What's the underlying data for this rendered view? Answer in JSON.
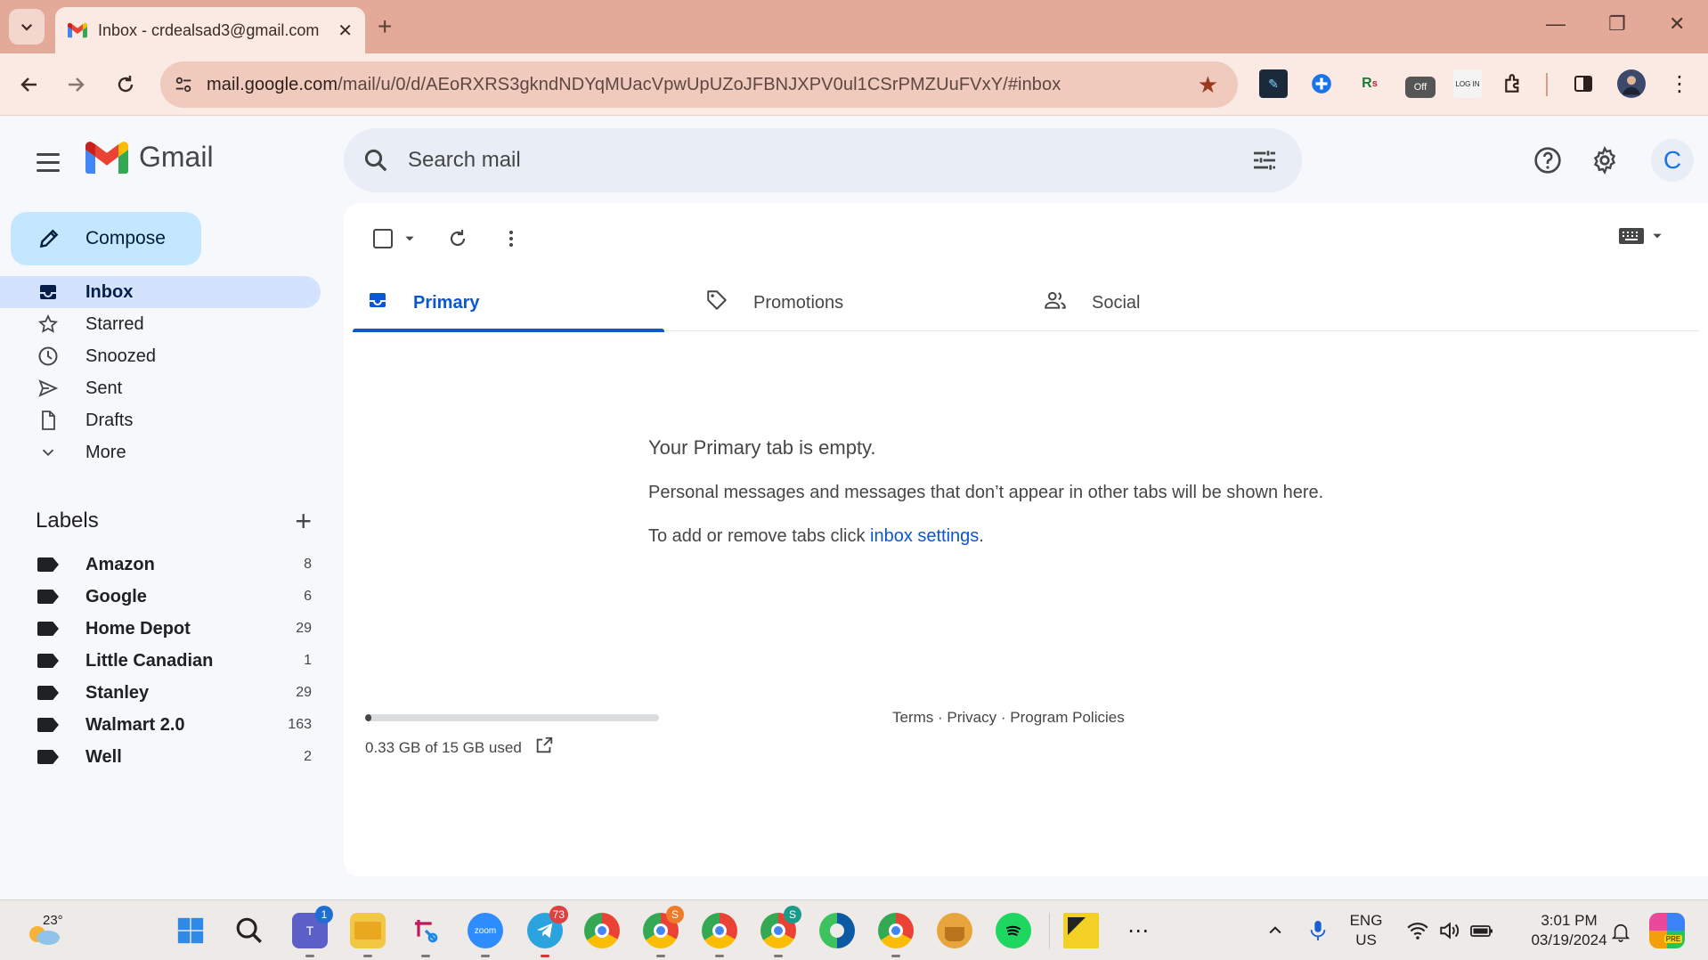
{
  "browser": {
    "tab_title": "Inbox - crdealsad3@gmail.com",
    "url_host": "mail.google.com",
    "url_path": "/mail/u/0/d/AEoRXRS3gkndNDYqMUacVpwUpUZoJFBNJXPV0ul1CSrPMZUuFVxY/#inbox"
  },
  "gmail": {
    "logo_text": "Gmail",
    "search": {
      "placeholder": "Search mail"
    },
    "account_initial": "C",
    "compose_label": "Compose",
    "nav": [
      {
        "label": "Inbox",
        "icon": "inbox-icon",
        "active": true
      },
      {
        "label": "Starred",
        "icon": "star-icon"
      },
      {
        "label": "Snoozed",
        "icon": "clock-icon"
      },
      {
        "label": "Sent",
        "icon": "send-icon"
      },
      {
        "label": "Drafts",
        "icon": "draft-icon"
      },
      {
        "label": "More",
        "icon": "chevron-down-icon"
      }
    ],
    "labels_title": "Labels",
    "labels": [
      {
        "name": "Amazon",
        "count": "8"
      },
      {
        "name": "Google",
        "count": "6"
      },
      {
        "name": "Home Depot",
        "count": "29"
      },
      {
        "name": "Little Canadian",
        "count": "1"
      },
      {
        "name": "Stanley",
        "count": "29"
      },
      {
        "name": "Walmart 2.0",
        "count": "163"
      },
      {
        "name": "Well",
        "count": "2"
      }
    ],
    "tabs": [
      {
        "label": "Primary",
        "active": true
      },
      {
        "label": "Promotions"
      },
      {
        "label": "Social"
      }
    ],
    "empty": {
      "title": "Your Primary tab is empty.",
      "body": "Personal messages and messages that don’t appear in other tabs will be shown here.",
      "hint_prefix": "To add or remove tabs click ",
      "hint_link": "inbox settings",
      "hint_suffix": "."
    },
    "storage": {
      "text": "0.33 GB of 15 GB used",
      "fraction": 0.022
    },
    "footer": {
      "terms": "Terms",
      "privacy": "Privacy",
      "policies": "Program Policies",
      "sep": " · "
    }
  },
  "taskbar": {
    "weather_temp": "23°",
    "teams_badge": "1",
    "telegram_badge": "73",
    "lang_top": "ENG",
    "lang_bottom": "US",
    "time": "3:01 PM",
    "date": "03/19/2024",
    "ext_off_label": "Off"
  },
  "colors": {
    "accent": "#0b57d0",
    "compose_bg": "#c2e7ff",
    "active_nav_bg": "#d3e3fd",
    "chrome_tabstrip": "#e3aa99",
    "chrome_toolbar": "#fbe9e3"
  }
}
